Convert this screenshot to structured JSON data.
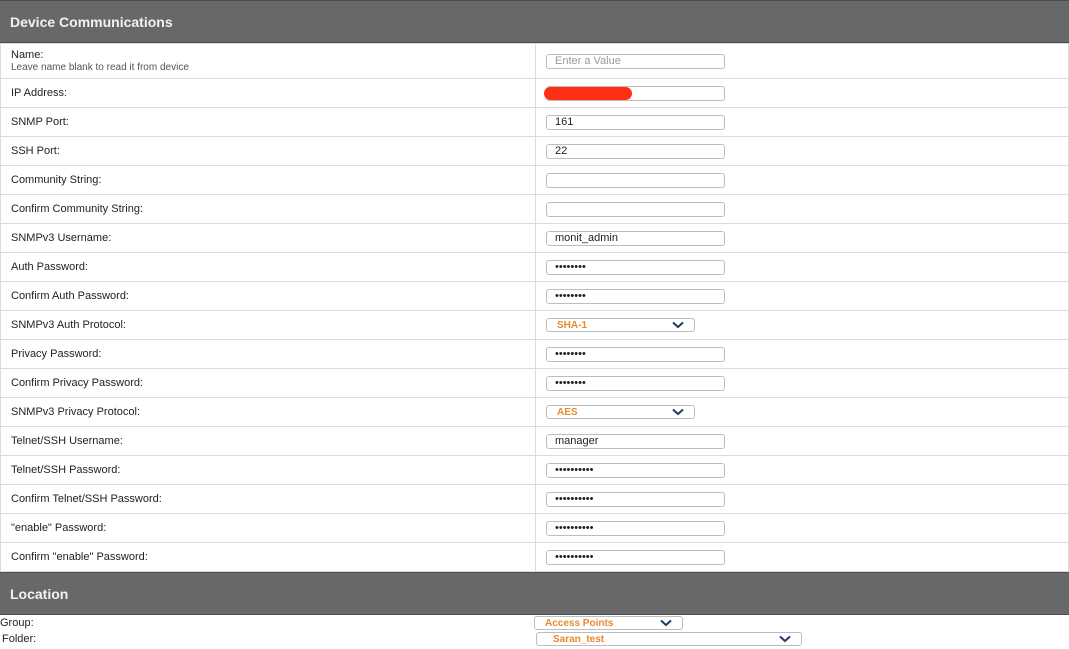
{
  "device_comm": {
    "title": "Device Communications",
    "name": {
      "label": "Name:",
      "sublabel": "Leave name blank to read it from device",
      "placeholder": "Enter a Value",
      "value": ""
    },
    "ip": {
      "label": "IP Address:",
      "value": ""
    },
    "snmp_port": {
      "label": "SNMP Port:",
      "value": "161"
    },
    "ssh_port": {
      "label": "SSH Port:",
      "value": "22"
    },
    "community": {
      "label": "Community String:",
      "value": ""
    },
    "confirm_community": {
      "label": "Confirm Community String:",
      "value": ""
    },
    "snmpv3_user": {
      "label": "SNMPv3 Username:",
      "value": "monit_admin"
    },
    "auth_pw": {
      "label": "Auth Password:",
      "value": "••••••••"
    },
    "confirm_auth_pw": {
      "label": "Confirm Auth Password:",
      "value": "••••••••"
    },
    "auth_protocol": {
      "label": "SNMPv3 Auth Protocol:",
      "value": "SHA-1"
    },
    "privacy_pw": {
      "label": "Privacy Password:",
      "value": "••••••••"
    },
    "confirm_privacy_pw": {
      "label": "Confirm Privacy Password:",
      "value": "••••••••"
    },
    "privacy_protocol": {
      "label": "SNMPv3 Privacy Protocol:",
      "value": "AES"
    },
    "telnet_user": {
      "label": "Telnet/SSH Username:",
      "value": "manager"
    },
    "telnet_pw": {
      "label": "Telnet/SSH Password:",
      "value": "••••••••••"
    },
    "confirm_telnet_pw": {
      "label": "Confirm Telnet/SSH Password:",
      "value": "••••••••••"
    },
    "enable_pw": {
      "label": "\"enable\" Password:",
      "value": "••••••••••"
    },
    "confirm_enable_pw": {
      "label": "Confirm \"enable\" Password:",
      "value": "••••••••••"
    }
  },
  "location": {
    "title": "Location",
    "group": {
      "label": "Group:",
      "value": "Access Points"
    },
    "folder": {
      "label": "Folder:",
      "value": "Saran_test"
    }
  },
  "colors": {
    "header_bg": "#67686a",
    "select_text": "#e8892b",
    "redaction": "#ff2e14",
    "chevron": "#1f3b6b"
  },
  "icons": {
    "dropdown": "chevron-down-icon"
  }
}
